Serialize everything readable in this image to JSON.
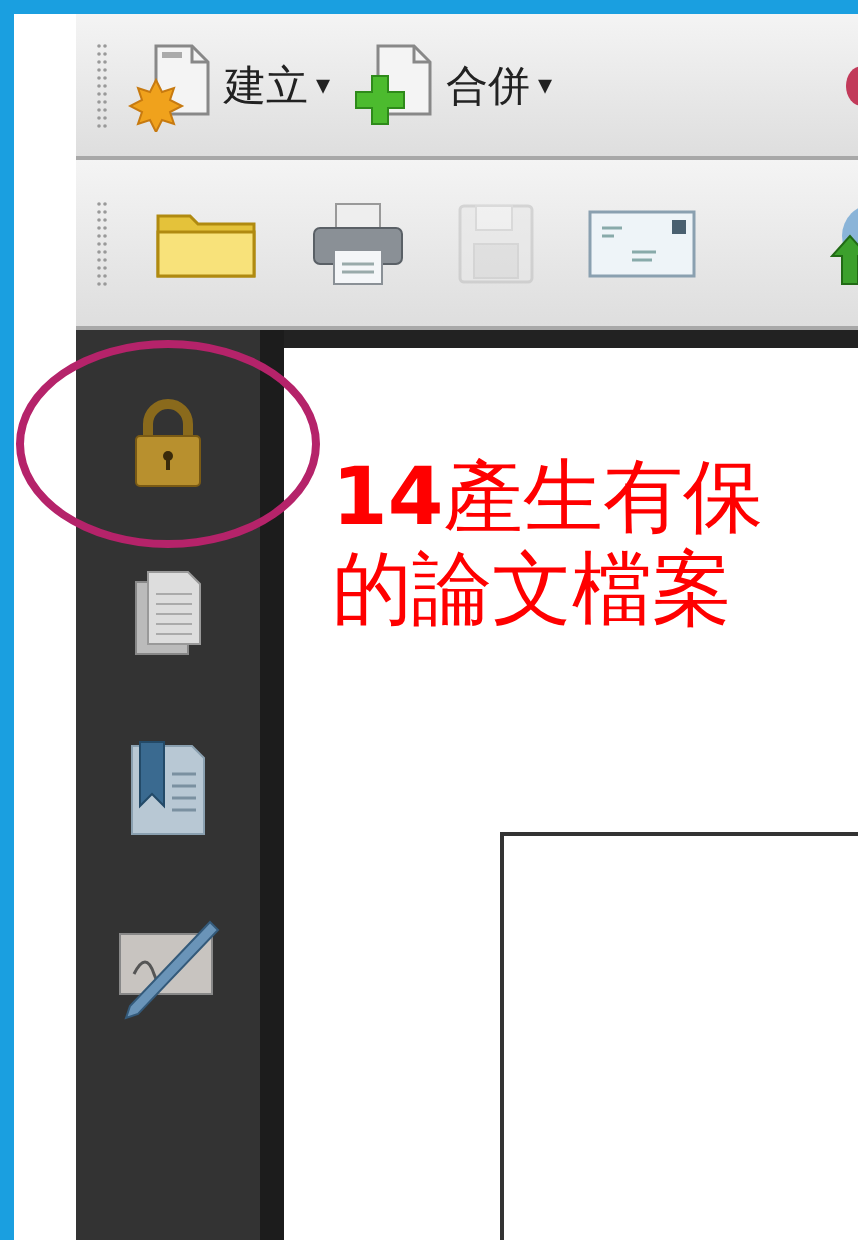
{
  "toolbars": [
    {
      "items": [
        {
          "kind": "create",
          "label": "建立",
          "caret": "▾"
        },
        {
          "kind": "merge",
          "label": "合併",
          "caret": "▾"
        },
        {
          "kind": "partial"
        }
      ]
    },
    {
      "items": [
        {
          "kind": "open",
          "disabled": false
        },
        {
          "kind": "print",
          "disabled": false
        },
        {
          "kind": "save",
          "disabled": true
        },
        {
          "kind": "email",
          "disabled": false
        },
        {
          "kind": "upload",
          "disabled": false
        }
      ]
    }
  ],
  "sidebar": {
    "items": [
      {
        "kind": "lock",
        "highlighted": true
      },
      {
        "kind": "pages",
        "highlighted": false
      },
      {
        "kind": "bookmarks",
        "highlighted": false
      },
      {
        "kind": "signatures",
        "highlighted": false
      }
    ]
  },
  "callout": {
    "lines": [
      "**14**產生有保",
      "的論文檔案"
    ]
  }
}
